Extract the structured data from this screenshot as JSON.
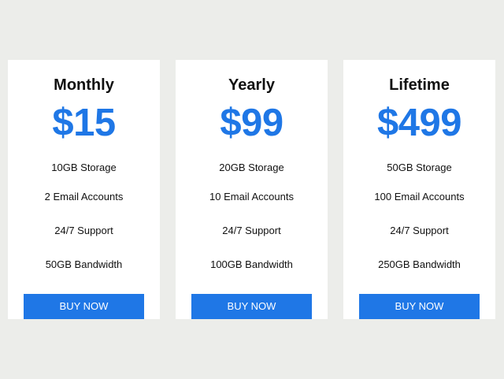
{
  "colors": {
    "background": "#ecedea",
    "card": "#ffffff",
    "accent": "#1f77e6",
    "text": "#111111"
  },
  "plans": [
    {
      "name": "Monthly",
      "price": "$15",
      "features": [
        "10GB Storage",
        "2 Email Accounts",
        "24/7 Support",
        "50GB Bandwidth"
      ],
      "button_label": "BUY NOW"
    },
    {
      "name": "Yearly",
      "price": "$99",
      "features": [
        "20GB Storage",
        "10 Email Accounts",
        "24/7 Support",
        "100GB Bandwidth"
      ],
      "button_label": "BUY NOW"
    },
    {
      "name": "Lifetime",
      "price": "$499",
      "features": [
        "50GB Storage",
        "100 Email Accounts",
        "24/7 Support",
        "250GB Bandwidth"
      ],
      "button_label": "BUY NOW"
    }
  ]
}
